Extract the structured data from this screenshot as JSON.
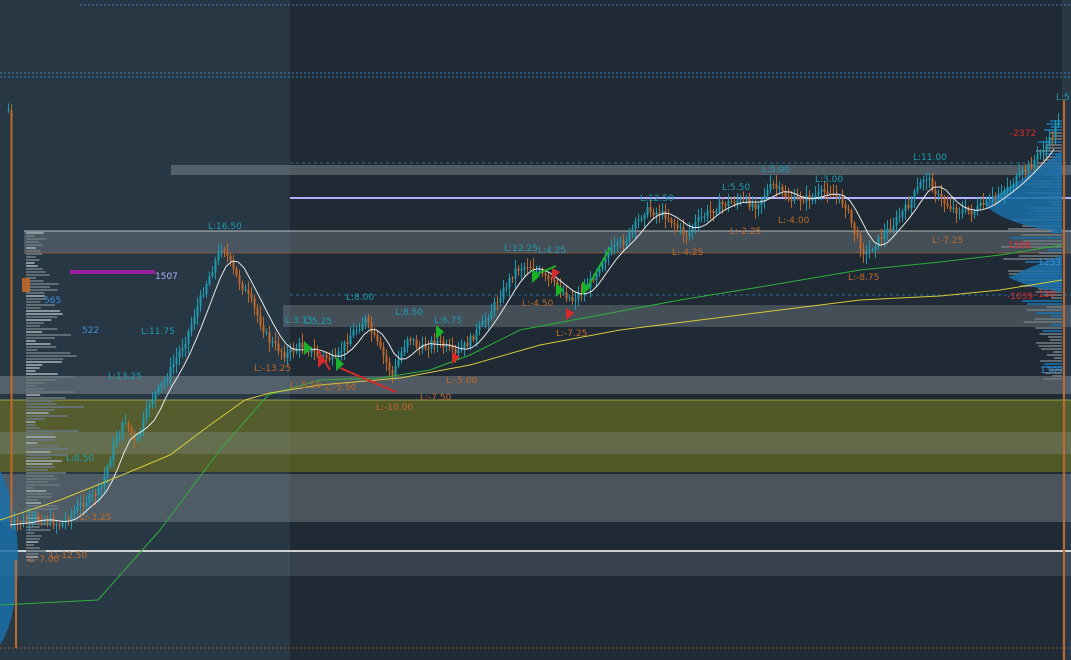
{
  "colors": {
    "background": "#1f2a35",
    "session_shade": "#283744",
    "bull": "#1e9bb0",
    "bear": "#c0692a",
    "band_gray": "#8a949c",
    "band_olive": "#7a7d1e",
    "ma_fast": "#e8e8e8",
    "ma_mid": "#2fae3a",
    "ma_slow": "#d6c93a",
    "level_purple": "#b0b0ff",
    "profile_blue": "#1a6fa8",
    "profile_gray": "#6a757d",
    "magenta": "#9b1fa0",
    "signal_green": "#19b32a",
    "signal_red": "#d42a2a",
    "text_red": "#e02828",
    "text_blue": "#3c8fd6"
  },
  "chart_data": {
    "type": "candlestick",
    "annotations": [
      {
        "text": "L:16.50",
        "kind": "high"
      },
      {
        "text": "L:11.75",
        "kind": "high"
      },
      {
        "text": "L:13.25",
        "kind": "high"
      },
      {
        "text": "L:8.50",
        "kind": "high"
      },
      {
        "text": "L:-13.25",
        "kind": "low"
      },
      {
        "text": "L:3.75",
        "kind": "high"
      },
      {
        "text": "L:5.25",
        "kind": "high"
      },
      {
        "text": "L:-5.50",
        "kind": "low"
      },
      {
        "text": "L:-5.50",
        "kind": "low"
      },
      {
        "text": "L:8.00",
        "kind": "high"
      },
      {
        "text": "L:-10.00",
        "kind": "low"
      },
      {
        "text": "L:8.50",
        "kind": "high"
      },
      {
        "text": "L:-7.50",
        "kind": "low"
      },
      {
        "text": "L:6.75",
        "kind": "high"
      },
      {
        "text": "L:-5.00",
        "kind": "low"
      },
      {
        "text": "L:12.25",
        "kind": "high"
      },
      {
        "text": "L:4.25",
        "kind": "high"
      },
      {
        "text": "L:-4.50",
        "kind": "low"
      },
      {
        "text": "L:-7.25",
        "kind": "low"
      },
      {
        "text": "L:12.50",
        "kind": "high"
      },
      {
        "text": "L:-4.25",
        "kind": "low"
      },
      {
        "text": "L:5.50",
        "kind": "high"
      },
      {
        "text": "L:-2.25",
        "kind": "low"
      },
      {
        "text": "L:5.00",
        "kind": "high"
      },
      {
        "text": "L:-4.00",
        "kind": "low"
      },
      {
        "text": "L:3.00",
        "kind": "high"
      },
      {
        "text": "L:-8.75",
        "kind": "low"
      },
      {
        "text": "L:11.00",
        "kind": "high"
      },
      {
        "text": "L:-7.25",
        "kind": "low"
      },
      {
        "text": "L:-7.00",
        "kind": "low"
      },
      {
        "text": "L:-12.50",
        "kind": "low"
      },
      {
        "text": "L:-3.25",
        "kind": "low"
      },
      {
        "text": "L:5.25",
        "kind": "high"
      }
    ],
    "profile_labels": [
      {
        "text": "1507",
        "color": "#b0b0ff"
      },
      {
        "text": "-2372",
        "color": "#e02828"
      },
      {
        "text": "-1039",
        "color": "#e02828"
      },
      {
        "text": "1308",
        "color": "#e02828"
      },
      {
        "text": "1233",
        "color": "#3c8fd6"
      },
      {
        "text": "-130",
        "color": "#e02828"
      },
      {
        "text": "1309",
        "color": "#3c8fd6"
      },
      {
        "text": "565",
        "color": "#3c8fd6"
      },
      {
        "text": "522",
        "color": "#3c8fd6"
      }
    ]
  }
}
